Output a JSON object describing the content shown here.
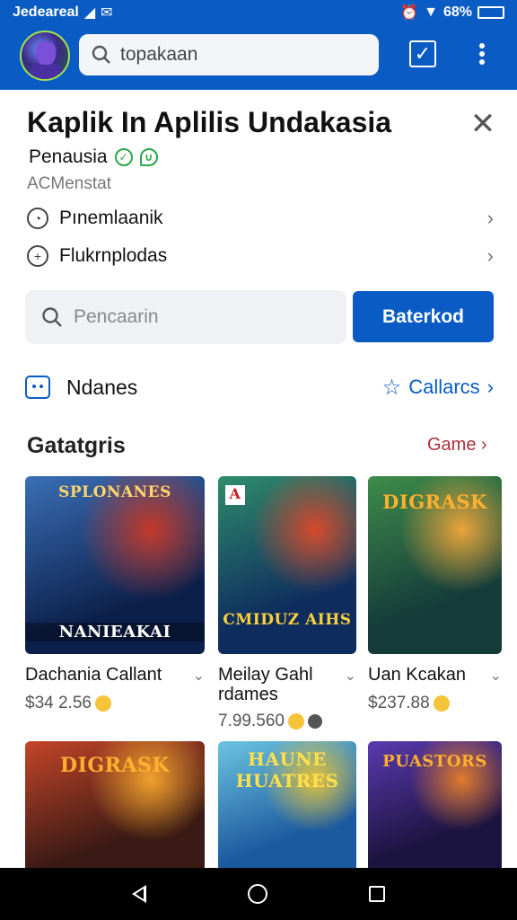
{
  "status": {
    "carrier": "Jedeareal",
    "battery": "68%"
  },
  "header": {
    "search_placeholder": "topakaan"
  },
  "app": {
    "title": "Kaplik In Aplilis Undakasia",
    "developer": "Penausia",
    "category": "ACMenstat",
    "rows": [
      {
        "label": "Pınemlaanik"
      },
      {
        "label": "Flukrnplodas"
      }
    ]
  },
  "search": {
    "placeholder": "Pencaarin",
    "button_label": "Baterkod"
  },
  "names_row": {
    "label": "Ndanes",
    "collections_label": "Callarcs"
  },
  "section": {
    "title": "Gatatgris",
    "link_label": "Game"
  },
  "cards": [
    {
      "name": "Dachania Callant",
      "price": "$34 2.56",
      "art_text": "SPLONANES",
      "art_sub": "NANIEAKAI",
      "colors": [
        "#0c1f4a",
        "#3a6fb6",
        "#c43a2a"
      ]
    },
    {
      "name": "Meilay Gahl rdames",
      "price": "7.99.560",
      "art_text": "CMIDUZ AIHS",
      "art_sub": "A",
      "colors": [
        "#0e2c5e",
        "#2f8c6c",
        "#d64a2c"
      ]
    },
    {
      "name": "Uan Kcakan",
      "price": "$237.88",
      "art_text": "DIGRASK",
      "art_sub": "",
      "colors": [
        "#143a3a",
        "#3e8c4a",
        "#e8a33a"
      ]
    },
    {
      "name": "",
      "price": "",
      "art_text": "DIGRASK",
      "art_sub": "",
      "colors": [
        "#3a1a14",
        "#c4452a",
        "#f0a22c"
      ]
    },
    {
      "name": "",
      "price": "",
      "art_text": "HAUNE HUATRES",
      "art_sub": "",
      "colors": [
        "#1c5aa0",
        "#6cc4e0",
        "#e0c03a"
      ]
    },
    {
      "name": "",
      "price": "",
      "art_text": "PUASTORS",
      "art_sub": "",
      "colors": [
        "#1c1440",
        "#5a3ab0",
        "#e07a2c"
      ]
    }
  ]
}
